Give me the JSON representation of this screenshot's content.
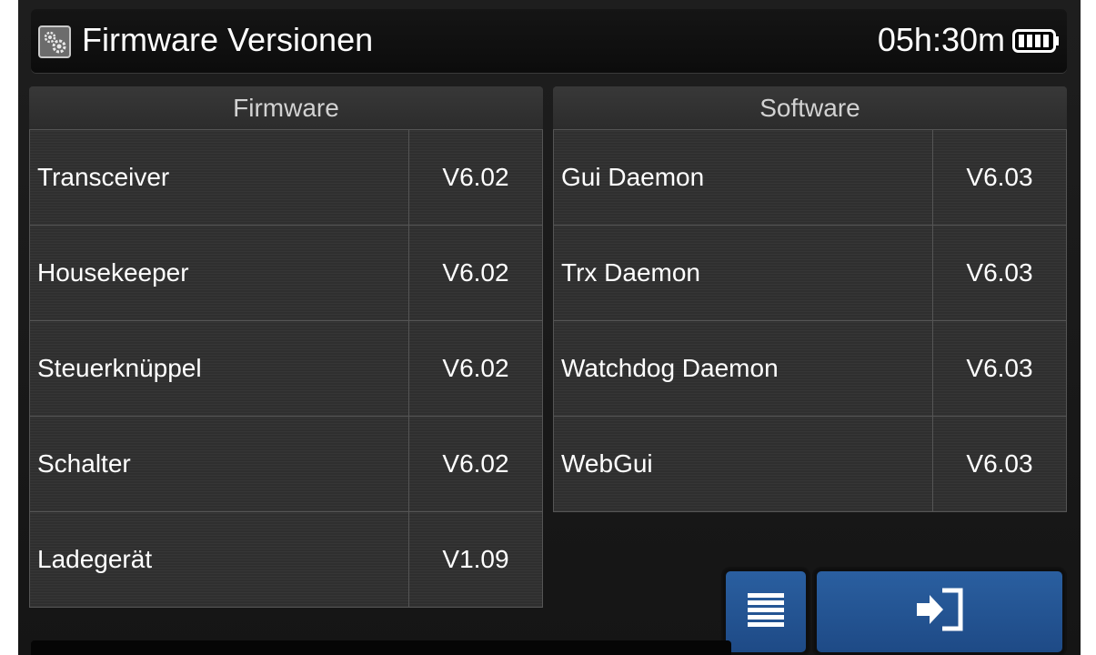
{
  "header": {
    "title": "Firmware Versionen",
    "time_remaining": "05h:30m",
    "icons": [
      "settings-gear-icon",
      "battery-icon"
    ]
  },
  "firmware": {
    "heading": "Firmware",
    "rows": [
      {
        "name": "Transceiver",
        "version": "V6.02"
      },
      {
        "name": "Housekeeper",
        "version": "V6.02"
      },
      {
        "name": "Steuerknüppel",
        "version": "V6.02"
      },
      {
        "name": "Schalter",
        "version": "V6.02"
      },
      {
        "name": "Ladegerät",
        "version": "V1.09"
      }
    ]
  },
  "software": {
    "heading": "Software",
    "rows": [
      {
        "name": "Gui Daemon",
        "version": "V6.03"
      },
      {
        "name": "Trx Daemon",
        "version": "V6.03"
      },
      {
        "name": "Watchdog Daemon",
        "version": "V6.03"
      },
      {
        "name": "WebGui",
        "version": "V6.03"
      }
    ]
  },
  "buttons": {
    "menu_icon": "menu-list-icon",
    "exit_icon": "exit-door-icon"
  },
  "colors": {
    "background": "#1b1b1b",
    "button": "#2a5fa0",
    "text": "#ffffff"
  }
}
